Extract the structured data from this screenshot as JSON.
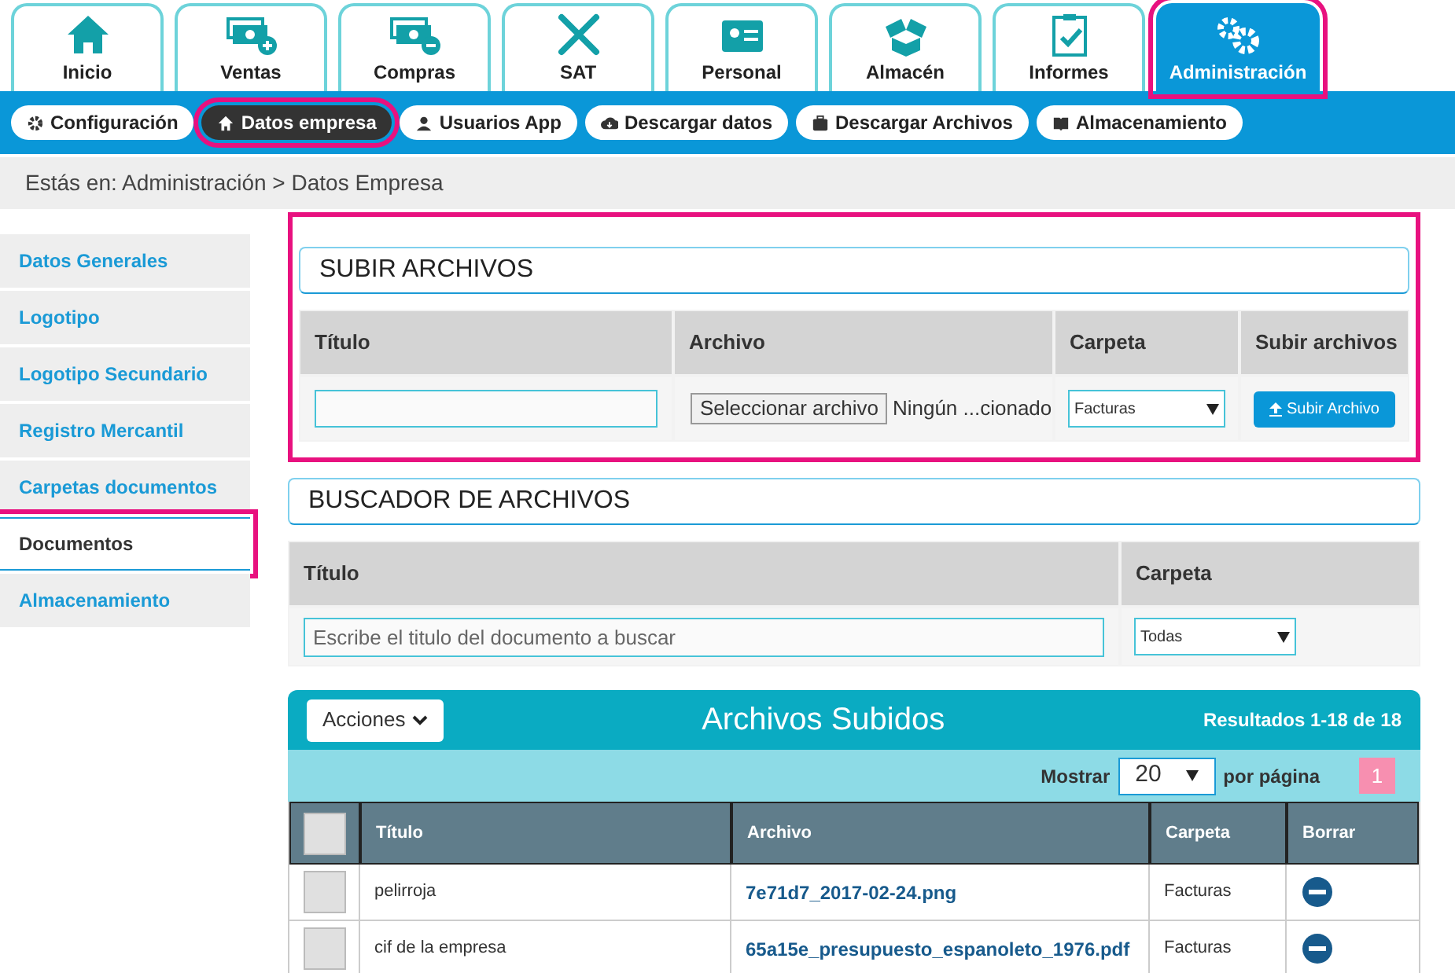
{
  "tabs": [
    {
      "label": "Inicio",
      "selected": false,
      "highlighted": false
    },
    {
      "label": "Ventas",
      "selected": false,
      "highlighted": false
    },
    {
      "label": "Compras",
      "selected": false,
      "highlighted": false
    },
    {
      "label": "SAT",
      "selected": false,
      "highlighted": false
    },
    {
      "label": "Personal",
      "selected": false,
      "highlighted": false
    },
    {
      "label": "Almacén",
      "selected": false,
      "highlighted": false
    },
    {
      "label": "Informes",
      "selected": false,
      "highlighted": false
    },
    {
      "label": "Administración",
      "selected": true,
      "highlighted": true
    }
  ],
  "subnav": [
    {
      "label": "Configuración",
      "selected": false,
      "highlighted": false
    },
    {
      "label": "Datos empresa",
      "selected": true,
      "highlighted": true
    },
    {
      "label": "Usuarios App",
      "selected": false,
      "highlighted": false
    },
    {
      "label": "Descargar datos",
      "selected": false,
      "highlighted": false
    },
    {
      "label": "Descargar Archivos",
      "selected": false,
      "highlighted": false
    },
    {
      "label": "Almacenamiento",
      "selected": false,
      "highlighted": false
    }
  ],
  "breadcrumb": "Estás en: Administración > Datos Empresa",
  "sidebar": {
    "items": [
      {
        "label": "Datos Generales",
        "selected": false,
        "highlighted": false
      },
      {
        "label": "Logotipo",
        "selected": false,
        "highlighted": false
      },
      {
        "label": "Logotipo Secundario",
        "selected": false,
        "highlighted": false
      },
      {
        "label": "Registro Mercantil",
        "selected": false,
        "highlighted": false
      },
      {
        "label": "Carpetas documentos",
        "selected": false,
        "highlighted": false
      },
      {
        "label": "Documentos",
        "selected": true,
        "highlighted": true
      },
      {
        "label": "Almacenamiento",
        "selected": false,
        "highlighted": false
      }
    ]
  },
  "upload": {
    "title": "SUBIR ARCHIVOS",
    "highlighted": true,
    "columns": [
      "Título",
      "Archivo",
      "Carpeta",
      "Subir archivos"
    ],
    "file_button": "Seleccionar archivo",
    "file_status": "Ningún ...cionado",
    "folder": "Facturas",
    "submit": "Subir Archivo"
  },
  "search": {
    "title": "BUSCADOR DE ARCHIVOS",
    "columns": [
      "Título",
      "Carpeta"
    ],
    "placeholder": "Escribe el titulo del documento a buscar",
    "folder": "Todas"
  },
  "files": {
    "actions": "Acciones",
    "title": "Archivos Subidos",
    "results": "Resultados 1-18 de 18",
    "show_label": "Mostrar",
    "page_size": "20",
    "per_page": "por página",
    "page": "1",
    "select_all_checked": false,
    "columns": [
      "Título",
      "Archivo",
      "Carpeta",
      "Borrar"
    ],
    "rows": [
      {
        "title": "pelirroja",
        "file": "7e71d7_2017-02-24.png",
        "folder": "Facturas",
        "checked": false
      },
      {
        "title": "cif de la empresa",
        "file": "65a15e_presupuesto_espanoleto_1976.pdf",
        "folder": "Facturas",
        "checked": false
      }
    ]
  }
}
